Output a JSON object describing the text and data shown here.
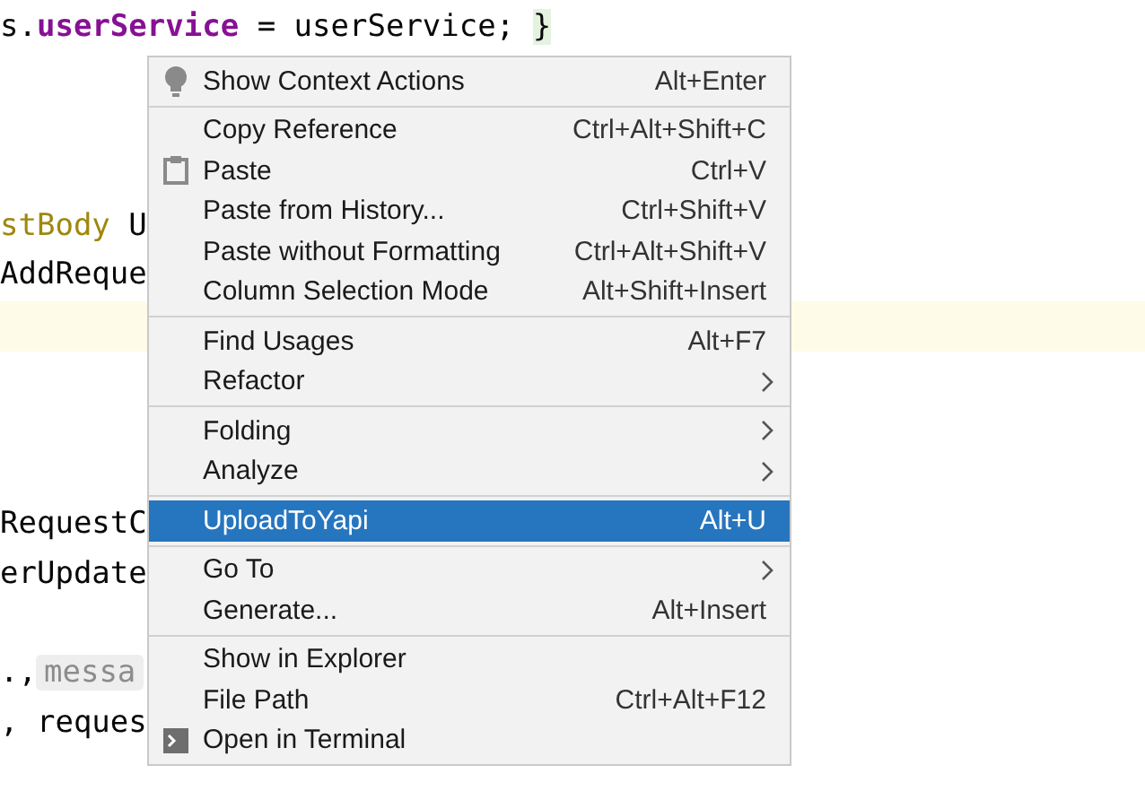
{
  "editor": {
    "lines": [
      {
        "highlighted": false,
        "tokens": [
          {
            "text": "s.",
            "kind": "plain"
          },
          {
            "text": "userService",
            "kind": "field"
          },
          {
            "text": " = userService; ",
            "kind": "plain"
          },
          {
            "text": "}",
            "kind": "matched"
          }
        ]
      },
      {
        "highlighted": false
      },
      {
        "highlighted": false
      },
      {
        "highlighted": false
      },
      {
        "highlighted": false,
        "tokens": [
          {
            "text": "stBody",
            "kind": "annotation"
          },
          {
            "text": " U",
            "kind": "plain"
          }
        ]
      },
      {
        "highlighted": false,
        "tokens": [
          {
            "text": "AddReque",
            "kind": "plain"
          }
        ]
      },
      {
        "highlighted": true
      },
      {
        "highlighted": false
      },
      {
        "highlighted": false
      },
      {
        "highlighted": false
      },
      {
        "highlighted": false,
        "tokens": [
          {
            "text": "RequestC",
            "kind": "plain"
          }
        ]
      },
      {
        "highlighted": false,
        "tokens": [
          {
            "text": "erUpdate",
            "kind": "plain"
          }
        ]
      },
      {
        "highlighted": false
      },
      {
        "highlighted": false,
        "tokens": [
          {
            "text": ".,",
            "kind": "plain"
          },
          {
            "text": "messa",
            "kind": "hint"
          }
        ]
      },
      {
        "highlighted": false,
        "tokens": [
          {
            "text": ", reques",
            "kind": "plain"
          }
        ]
      }
    ]
  },
  "context_menu": {
    "items": [
      {
        "kind": "bulb",
        "label": "Show Context Actions",
        "shortcut": "Alt+Enter",
        "submenu": false,
        "selected": false
      },
      {
        "kind": "separator"
      },
      {
        "kind": "item",
        "label": "Copy Reference",
        "shortcut": "Ctrl+Alt+Shift+C",
        "submenu": false,
        "selected": false
      },
      {
        "kind": "clipboard",
        "label": "Paste",
        "shortcut": "Ctrl+V",
        "submenu": false,
        "selected": false
      },
      {
        "kind": "item",
        "label": "Paste from History...",
        "shortcut": "Ctrl+Shift+V",
        "submenu": false,
        "selected": false
      },
      {
        "kind": "item",
        "label": "Paste without Formatting",
        "shortcut": "Ctrl+Alt+Shift+V",
        "submenu": false,
        "selected": false
      },
      {
        "kind": "item",
        "label": "Column Selection Mode",
        "shortcut": "Alt+Shift+Insert",
        "submenu": false,
        "selected": false
      },
      {
        "kind": "separator"
      },
      {
        "kind": "item",
        "label": "Find Usages",
        "shortcut": "Alt+F7",
        "submenu": false,
        "selected": false
      },
      {
        "kind": "item",
        "label": "Refactor",
        "submenu": true,
        "selected": false
      },
      {
        "kind": "separator"
      },
      {
        "kind": "item",
        "label": "Folding",
        "submenu": true,
        "selected": false
      },
      {
        "kind": "item",
        "label": "Analyze",
        "submenu": true,
        "selected": false
      },
      {
        "kind": "separator"
      },
      {
        "kind": "item",
        "label": "UploadToYapi",
        "shortcut": "Alt+U",
        "submenu": false,
        "selected": true
      },
      {
        "kind": "separator"
      },
      {
        "kind": "item",
        "label": "Go To",
        "submenu": true,
        "selected": false
      },
      {
        "kind": "item",
        "label": "Generate...",
        "shortcut": "Alt+Insert",
        "submenu": false,
        "selected": false
      },
      {
        "kind": "separator"
      },
      {
        "kind": "item",
        "label": "Show in Explorer",
        "submenu": false,
        "selected": false
      },
      {
        "kind": "item",
        "label": "File Path",
        "shortcut": "Ctrl+Alt+F12",
        "submenu": false,
        "selected": false
      },
      {
        "kind": "terminal",
        "label": "Open in Terminal",
        "submenu": false,
        "selected": false
      }
    ]
  }
}
